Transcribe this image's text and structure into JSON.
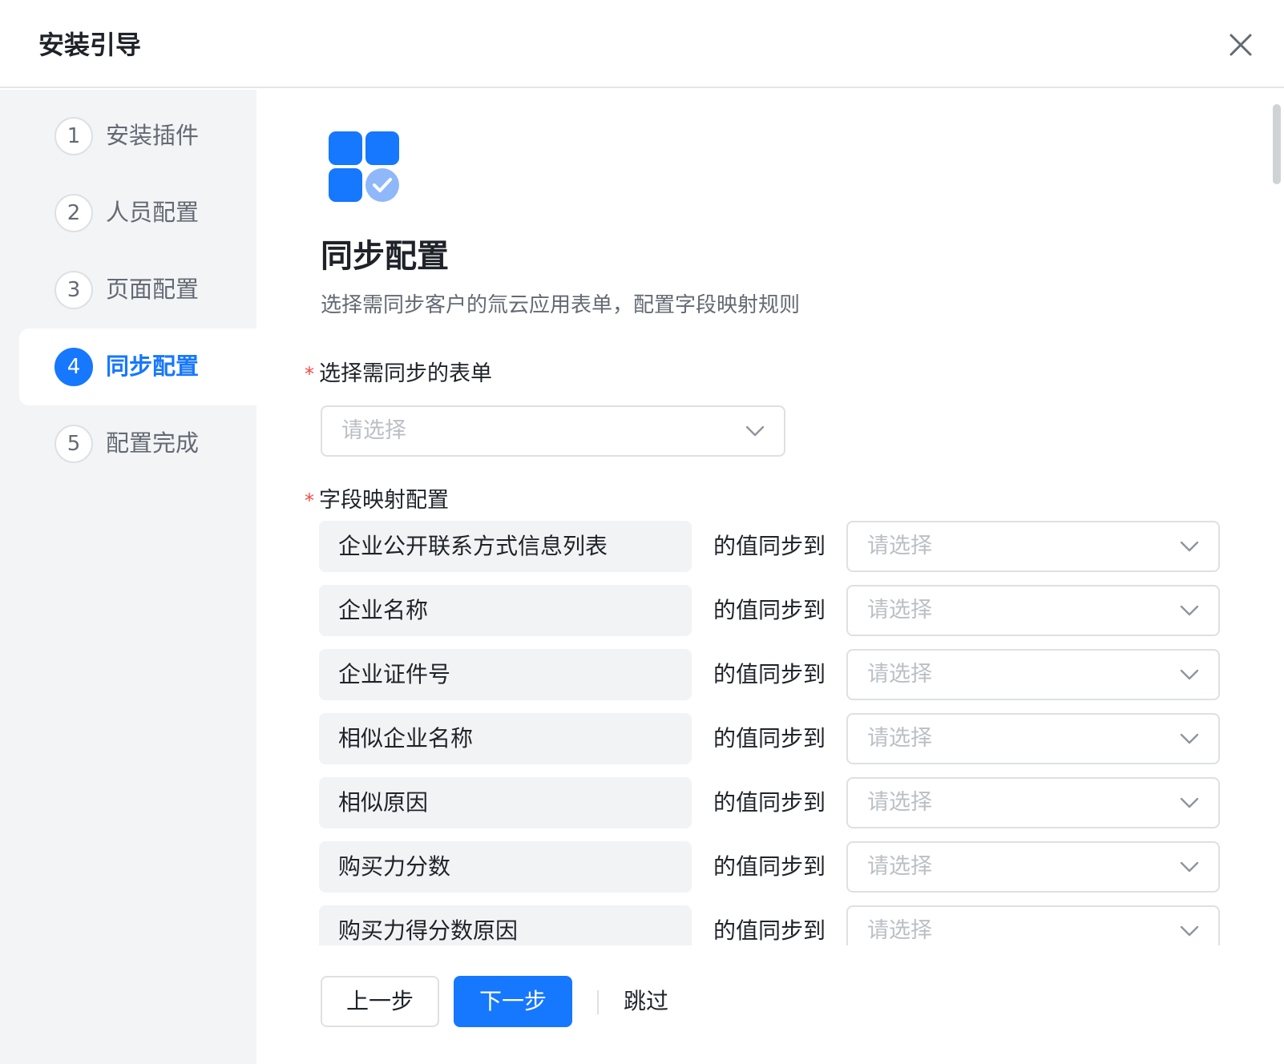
{
  "dialog": {
    "title": "安装引导"
  },
  "steps": [
    {
      "num": "1",
      "label": "安装插件",
      "active": false
    },
    {
      "num": "2",
      "label": "人员配置",
      "active": false
    },
    {
      "num": "3",
      "label": "页面配置",
      "active": false
    },
    {
      "num": "4",
      "label": "同步配置",
      "active": true
    },
    {
      "num": "5",
      "label": "配置完成",
      "active": false
    }
  ],
  "main": {
    "title": "同步配置",
    "description": "选择需同步客户的氚云应用表单，配置字段映射规则",
    "form_select_label": "选择需同步的表单",
    "form_select_placeholder": "请选择",
    "mapping_label": "字段映射配置",
    "required_mark": "*",
    "sync_text": "的值同步到",
    "mapping_placeholder": "请选择",
    "mappings": [
      {
        "field": "企业公开联系方式信息列表"
      },
      {
        "field": "企业名称"
      },
      {
        "field": "企业证件号"
      },
      {
        "field": "相似企业名称"
      },
      {
        "field": "相似原因"
      },
      {
        "field": "购买力分数"
      },
      {
        "field": "购买力得分数原因"
      }
    ]
  },
  "footer": {
    "prev": "上一步",
    "next": "下一步",
    "skip": "跳过"
  },
  "colors": {
    "primary": "#1677ff",
    "sidebar_bg": "#f3f4f6",
    "field_bg": "#f2f3f5",
    "required": "#f54a45"
  },
  "icons": {
    "close": "close-icon",
    "hero": "apps-check-icon",
    "dropdown": "chevron-down-icon"
  }
}
